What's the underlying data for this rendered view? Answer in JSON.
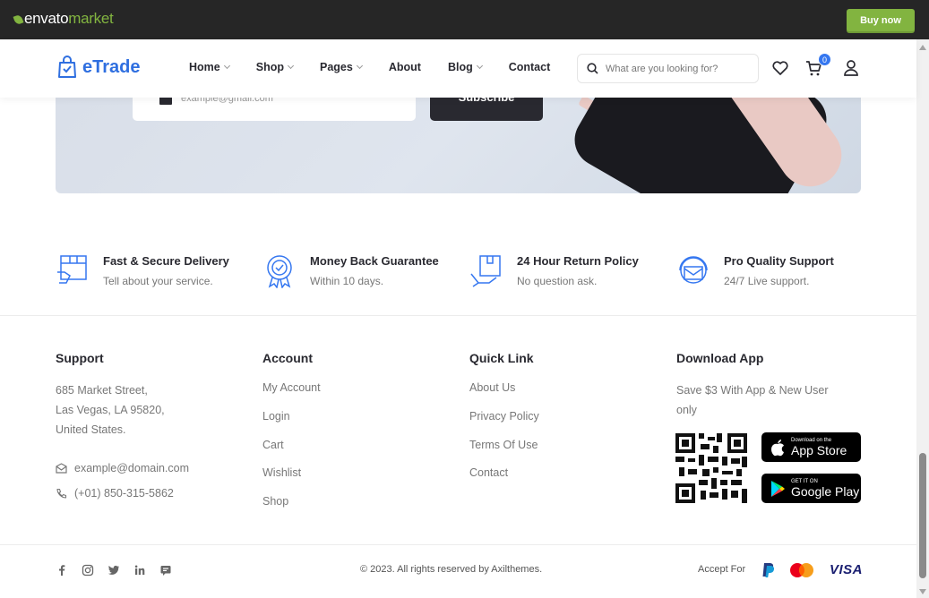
{
  "envato": {
    "logo_main": "envato",
    "logo_sub": "market",
    "buy_label": "Buy now"
  },
  "header": {
    "brand": "eTrade",
    "nav": [
      {
        "label": "Home",
        "has_dropdown": true
      },
      {
        "label": "Shop",
        "has_dropdown": true
      },
      {
        "label": "Pages",
        "has_dropdown": true
      },
      {
        "label": "About",
        "has_dropdown": false
      },
      {
        "label": "Blog",
        "has_dropdown": true
      },
      {
        "label": "Contact",
        "has_dropdown": false
      }
    ],
    "search_placeholder": "What are you looking for?",
    "cart_count": "0",
    "icons": [
      "search-icon",
      "heart-icon",
      "cart-icon",
      "user-icon"
    ]
  },
  "newsletter": {
    "email_placeholder": "example@gmail.com",
    "subscribe_label": "Subscribe"
  },
  "features": [
    {
      "icon": "delivery-truck-icon",
      "title": "Fast & Secure Delivery",
      "desc": "Tell about your service."
    },
    {
      "icon": "guarantee-badge-icon",
      "title": "Money Back Guarantee",
      "desc": "Within 10 days."
    },
    {
      "icon": "return-box-icon",
      "title": "24 Hour Return Policy",
      "desc": "No question ask."
    },
    {
      "icon": "support-headset-icon",
      "title": "Pro Quality Support",
      "desc": "24/7 Live support."
    }
  ],
  "footer": {
    "support": {
      "title": "Support",
      "address": [
        "685 Market Street,",
        "Las Vegas, LA 95820,",
        "United States."
      ],
      "email": "example@domain.com",
      "phone": "(+01) 850-315-5862"
    },
    "account": {
      "title": "Account",
      "links": [
        "My Account",
        "Login",
        "Cart",
        "Wishlist",
        "Shop"
      ]
    },
    "quick_link": {
      "title": "Quick Link",
      "links": [
        "About Us",
        "Privacy Policy",
        "Terms Of Use",
        "Contact"
      ]
    },
    "download_app": {
      "title": "Download App",
      "text": "Save $3 With App & New User only",
      "app_store_small": "Download on the",
      "app_store_big": "App Store",
      "google_play_small": "GET IT ON",
      "google_play_big": "Google Play"
    }
  },
  "bottom": {
    "social": [
      "facebook-icon",
      "instagram-icon",
      "twitter-icon",
      "linkedin-icon",
      "discord-icon"
    ],
    "copyright": "© 2023. All rights reserved by Axilthemes.",
    "accept_label": "Accept For",
    "payments": [
      "PayPal",
      "Mastercard",
      "VISA"
    ]
  },
  "colors": {
    "brand_blue": "#3577f0",
    "envato_green": "#82b440",
    "dark": "#292930",
    "muted": "#777777"
  }
}
